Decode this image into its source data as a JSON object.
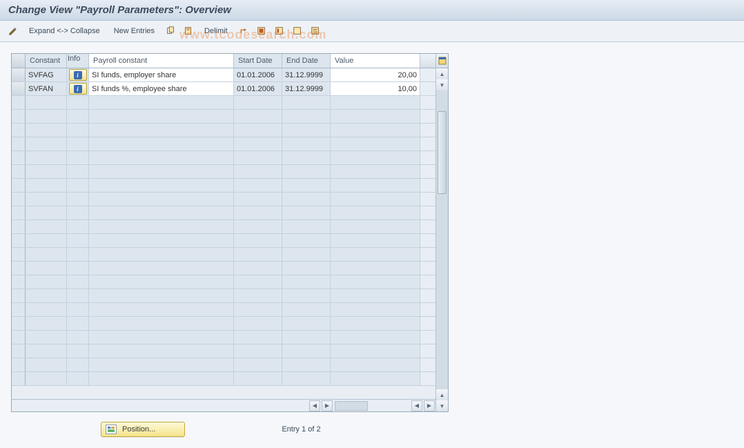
{
  "title": "Change View \"Payroll Parameters\": Overview",
  "watermark": "www.tcodesearch.com",
  "toolbar": {
    "expand_collapse": "Expand <-> Collapse",
    "new_entries": "New Entries",
    "delimit": "Delimit"
  },
  "table": {
    "headers": {
      "constant": "Constant",
      "info": "Info",
      "payroll_constant": "Payroll constant",
      "start_date": "Start Date",
      "end_date": "End Date",
      "value": "Value"
    },
    "rows": [
      {
        "constant": "SVFAG",
        "payroll_constant": "SI funds, employer share",
        "start_date": "01.01.2006",
        "end_date": "31.12.9999",
        "value": "20,00"
      },
      {
        "constant": "SVFAN",
        "payroll_constant": "SI funds %,  employee share",
        "start_date": "01.01.2006",
        "end_date": "31.12.9999",
        "value": "10,00"
      }
    ]
  },
  "footer": {
    "position_label": "Position...",
    "entry_text": "Entry 1 of 2"
  }
}
